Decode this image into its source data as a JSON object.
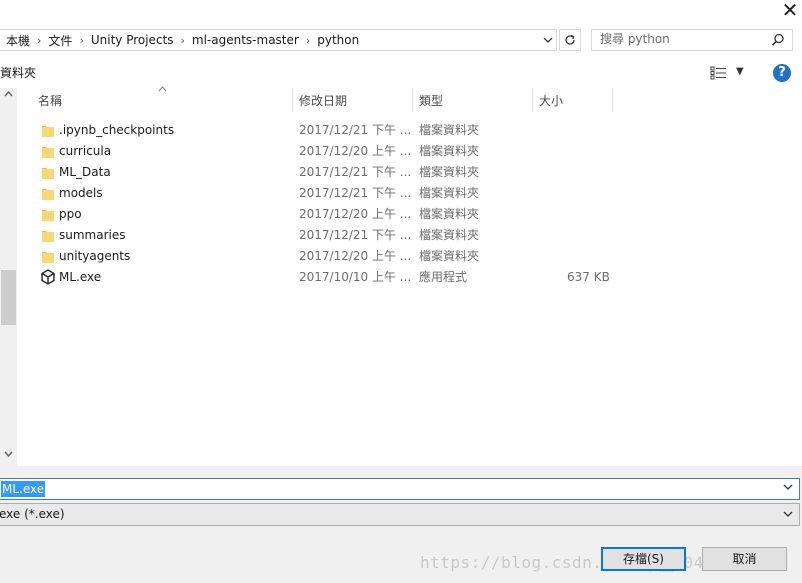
{
  "window": {
    "close_glyph": "✕"
  },
  "breadcrumb": [
    "本機",
    "文件",
    "Unity Projects",
    "ml-agents-master",
    "python"
  ],
  "search": {
    "placeholder": "搜尋 python"
  },
  "toolbar": {
    "left_label": "資料夾"
  },
  "columns": {
    "name": "名稱",
    "date": "修改日期",
    "type": "類型",
    "size": "大小"
  },
  "files": [
    {
      "name": ".ipynb_checkpoints",
      "date": "2017/12/21 下午 ...",
      "type": "檔案資料夾",
      "size": "",
      "icon": "folder-icon"
    },
    {
      "name": "curricula",
      "date": "2017/12/20 上午 ...",
      "type": "檔案資料夾",
      "size": "",
      "icon": "folder-icon"
    },
    {
      "name": "ML_Data",
      "date": "2017/12/21 下午 ...",
      "type": "檔案資料夾",
      "size": "",
      "icon": "folder-icon"
    },
    {
      "name": "models",
      "date": "2017/12/21 下午 ...",
      "type": "檔案資料夾",
      "size": "",
      "icon": "folder-icon"
    },
    {
      "name": "ppo",
      "date": "2017/12/20 上午 ...",
      "type": "檔案資料夾",
      "size": "",
      "icon": "folder-icon"
    },
    {
      "name": "summaries",
      "date": "2017/12/21 下午 ...",
      "type": "檔案資料夾",
      "size": "",
      "icon": "folder-icon"
    },
    {
      "name": "unityagents",
      "date": "2017/12/20 上午 ...",
      "type": "檔案資料夾",
      "size": "",
      "icon": "folder-icon"
    },
    {
      "name": "ML.exe",
      "date": "2017/10/10 上午 ...",
      "type": "應用程式",
      "size": "637 KB",
      "icon": "unity-app-icon"
    }
  ],
  "filename_field": {
    "value": "ML.exe"
  },
  "filetype_field": {
    "value": "exe (*.exe)"
  },
  "buttons": {
    "save": "存檔(S)",
    "cancel": "取消"
  },
  "watermark": "https://blog.csdn.net/qq_40458644",
  "colors": {
    "accent": "#0078d7",
    "selection": "#3399ff",
    "folder": "#f8d775",
    "help": "#1e73c8"
  }
}
